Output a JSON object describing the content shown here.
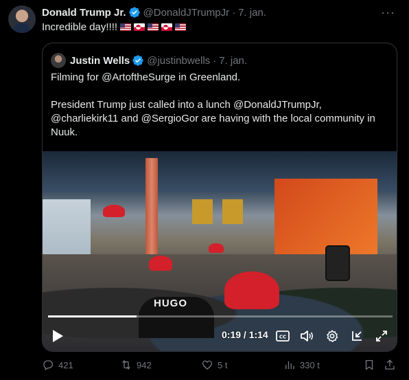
{
  "post": {
    "author_name": "Donald Trump Jr.",
    "author_handle": "@DonaldJTrumpJr",
    "separator": "·",
    "date": "7. jan.",
    "text": "Incredible day!!!!",
    "flags": [
      "us",
      "gl",
      "us",
      "gl",
      "us"
    ]
  },
  "quote": {
    "author_name": "Justin Wells",
    "author_handle": "@justinbwells",
    "separator": "·",
    "date": "7. jan.",
    "paragraph_1": "Filming for @ArtoftheSurge in Greenland.",
    "paragraph_2": "President Trump just called into a lunch @DonaldJTrumpJr, @charliekirk11 and @SergioGor are having with the local community in Nuuk.",
    "video": {
      "time": "0:19 / 1:14",
      "progress": 0.257,
      "shirt_text": "HUGO"
    }
  },
  "actions": {
    "replies": "421",
    "reposts": "942",
    "likes": "5 t",
    "views": "330 t"
  },
  "colors": {
    "background": "#000000",
    "text": "#e7e9ea",
    "muted": "#71767b",
    "verified": "#1d9bf0",
    "border": "#2f3336"
  }
}
